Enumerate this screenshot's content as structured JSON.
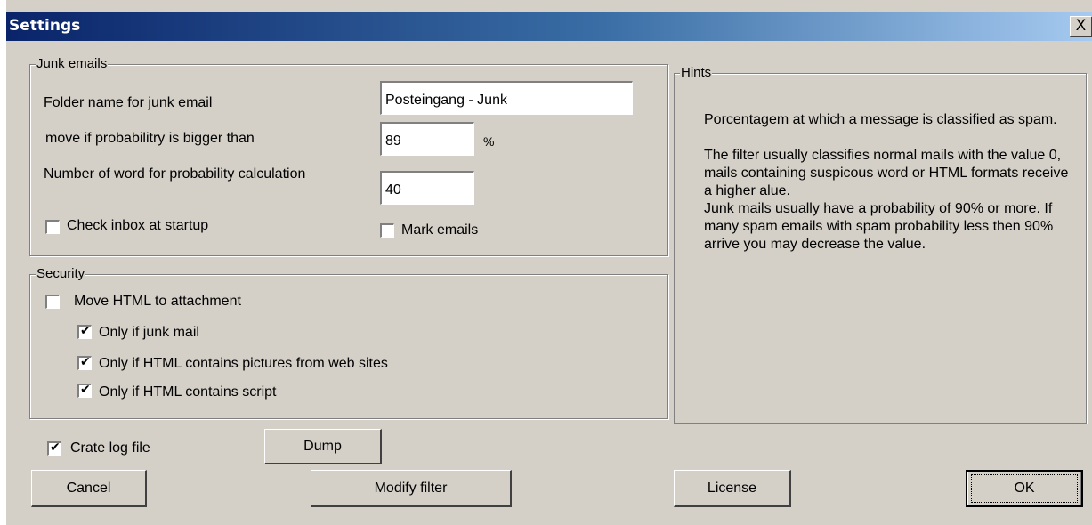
{
  "window": {
    "title": "Settings",
    "close_glyph": "X"
  },
  "junk": {
    "legend": "Junk emails",
    "folder_label": "Folder name for junk email",
    "folder_value": "Posteingang - Junk",
    "move_label": "move if probabilitry is bigger than",
    "move_value": "89",
    "percent": "%",
    "words_label": "Number of word for probability calculation",
    "words_value": "40",
    "check_inbox_label": "Check inbox at startup",
    "check_inbox_checked": false,
    "mark_emails_label": "Mark emails",
    "mark_emails_checked": false
  },
  "security": {
    "legend": "Security",
    "move_html_label": "Move HTML to attachment",
    "move_html_checked": false,
    "only_junk_label": "Only if junk mail",
    "only_junk_checked": true,
    "only_pictures_label": "Only if HTML contains pictures from web sites",
    "only_pictures_checked": true,
    "only_script_label": "Only if HTML contains script",
    "only_script_checked": true
  },
  "hints": {
    "legend": "Hints",
    "text": "Porcentagem at which a message is classified as spam.\n\nThe filter usually classifies normal mails with the value 0, mails containing suspicous word or HTML formats receive a higher alue.\nJunk mails usually have a probability of 90% or more. If many spam emails with spam probability less then 90% arrive you may decrease the value."
  },
  "log": {
    "label": "Crate log file",
    "checked": true
  },
  "buttons": {
    "dump": "Dump",
    "cancel": "Cancel",
    "modify_filter": "Modify filter",
    "license": "License",
    "ok": "OK"
  },
  "icons": {
    "checkmark": "checkmark-icon",
    "close": "close-icon"
  }
}
